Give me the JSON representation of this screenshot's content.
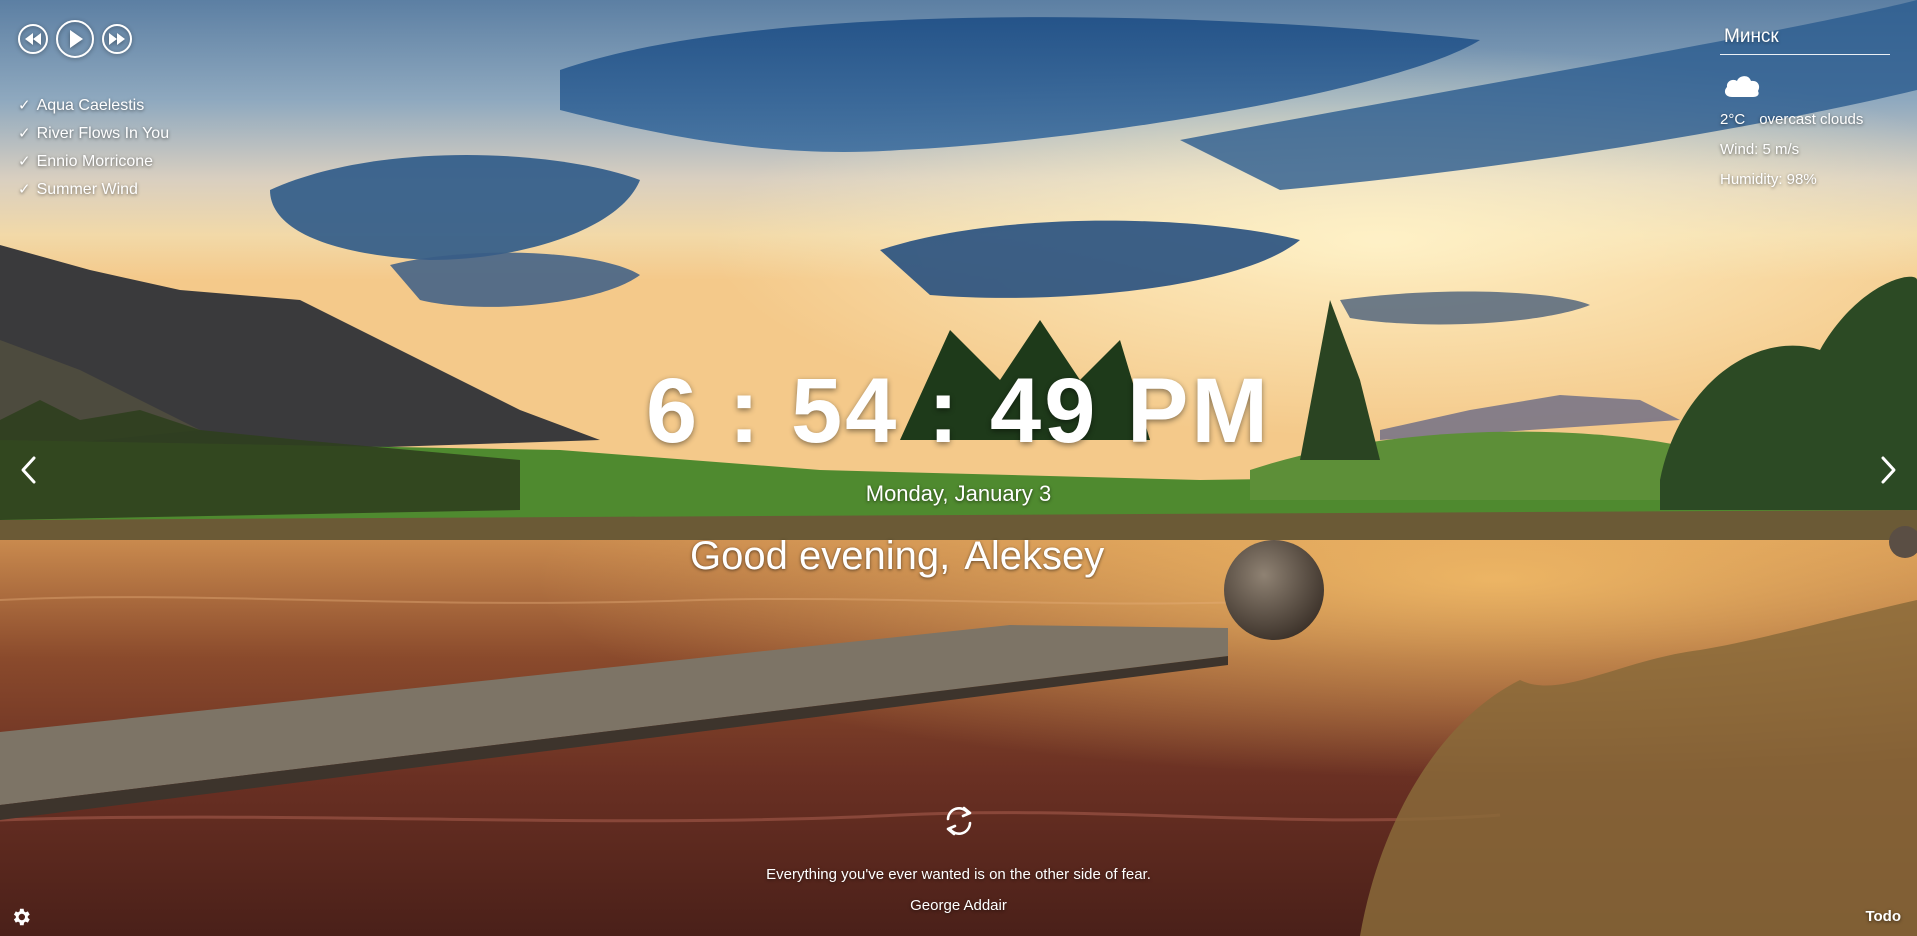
{
  "player": {
    "controls": [
      {
        "name": "prev-button",
        "icon": "rewind-icon"
      },
      {
        "name": "play-button",
        "icon": "play-icon"
      },
      {
        "name": "next-button",
        "icon": "fast-forward-icon"
      }
    ],
    "playlist": [
      {
        "title": "Aqua Caelestis"
      },
      {
        "title": "River Flows In You"
      },
      {
        "title": "Ennio Morricone"
      },
      {
        "title": "Summer Wind"
      }
    ],
    "check_glyph": "✓"
  },
  "weather": {
    "city": "Минск",
    "icon": "cloud-icon",
    "temperature": "2°C",
    "description": "overcast clouds",
    "wind": "Wind: 5 m/s",
    "humidity": "Humidity: 98%"
  },
  "clock": {
    "time": "6 : 54 : 49  PM",
    "date": "Monday, January 3"
  },
  "greeting": {
    "text": "Good evening,",
    "name": "Aleksey"
  },
  "slider": {
    "prev_icon": "chevron-left-icon",
    "next_icon": "chevron-right-icon"
  },
  "quote": {
    "text": "Everything you've ever wanted is on the other side of fear.",
    "author": "George Addair",
    "refresh_icon": "refresh-icon"
  },
  "footer": {
    "settings_icon": "gear-icon",
    "todo_label": "Todo"
  },
  "colors": {
    "text": "#ffffff"
  }
}
